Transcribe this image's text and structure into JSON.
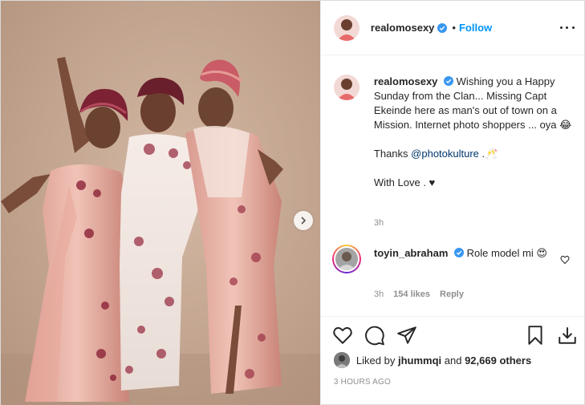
{
  "post": {
    "username": "realomosexy",
    "follow_label": "Follow",
    "dot": "•",
    "caption": {
      "username": "realomosexy",
      "line1": "Wishing you a Happy Sunday from the Clan... Missing Capt Ekeinde here as man's out of town on a Mission. Internet photo shoppers ... oya 😂",
      "thanks_prefix": "Thanks ",
      "mention": "@photokulture",
      "thanks_suffix": " .🥂",
      "love": "With Love . ♥",
      "time": "3h"
    },
    "comment": {
      "username": "toyin_abraham",
      "text": "Role model mi 😍",
      "time": "3h",
      "likes": "154 likes",
      "reply_label": "Reply"
    },
    "likes": {
      "prefix": "Liked by ",
      "user": "jhummqi",
      "middle": " and ",
      "others": "92,669 others"
    },
    "posted_ago": "3 HOURS AGO"
  },
  "icons": {
    "verified": "verified-badge-icon",
    "more": "more-options-icon",
    "next": "chevron-right-icon",
    "like": "heart-icon",
    "comment": "comment-icon",
    "share": "paper-plane-icon",
    "save": "bookmark-icon",
    "download": "download-icon"
  },
  "colors": {
    "accent": "#0095f6",
    "verified": "#3897f0",
    "muted": "#8e8e8e",
    "text": "#262626",
    "mention": "#00376b"
  }
}
